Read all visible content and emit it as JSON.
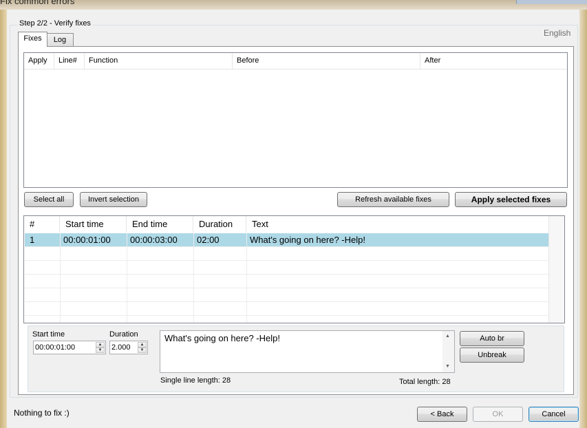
{
  "window": {
    "title": "Fix common errors"
  },
  "group": {
    "title": "Step 2/2 - Verify fixes"
  },
  "language": "English",
  "tabs": [
    {
      "label": "Fixes",
      "active": true
    },
    {
      "label": "Log",
      "active": false
    }
  ],
  "fixes_list": {
    "columns": [
      "Apply",
      "Line#",
      "Function",
      "Before",
      "After"
    ],
    "rows": []
  },
  "buttons": {
    "select_all": "Select all",
    "invert_selection": "Invert selection",
    "refresh_fixes": "Refresh available fixes",
    "apply_fixes": "Apply selected fixes",
    "auto_br": "Auto br",
    "unbreak": "Unbreak",
    "back": "< Back",
    "ok": "OK",
    "cancel": "Cancel"
  },
  "subtitles": {
    "columns": [
      "#",
      "Start time",
      "End time",
      "Duration",
      "Text"
    ],
    "rows": [
      {
        "num": "1",
        "start": "00:00:01:00",
        "end": "00:00:03:00",
        "duration": "02:00",
        "text": "What's going on here? -Help!",
        "selected": true
      }
    ]
  },
  "editor": {
    "start_time_label": "Start time",
    "start_time_value": "00:00:01:00",
    "duration_label": "Duration",
    "duration_value": "2.000",
    "text": "What's going on here? -Help!",
    "single_line_length": "Single line length: 28",
    "total_length": "Total length: 28"
  },
  "status": "Nothing to fix :)",
  "colors": {
    "selection": "#add8e6",
    "default_button_border": "#3c7fb1"
  },
  "icons": [
    "spin-up-icon",
    "spin-down-icon",
    "scroll-up-icon",
    "scroll-down-icon"
  ]
}
